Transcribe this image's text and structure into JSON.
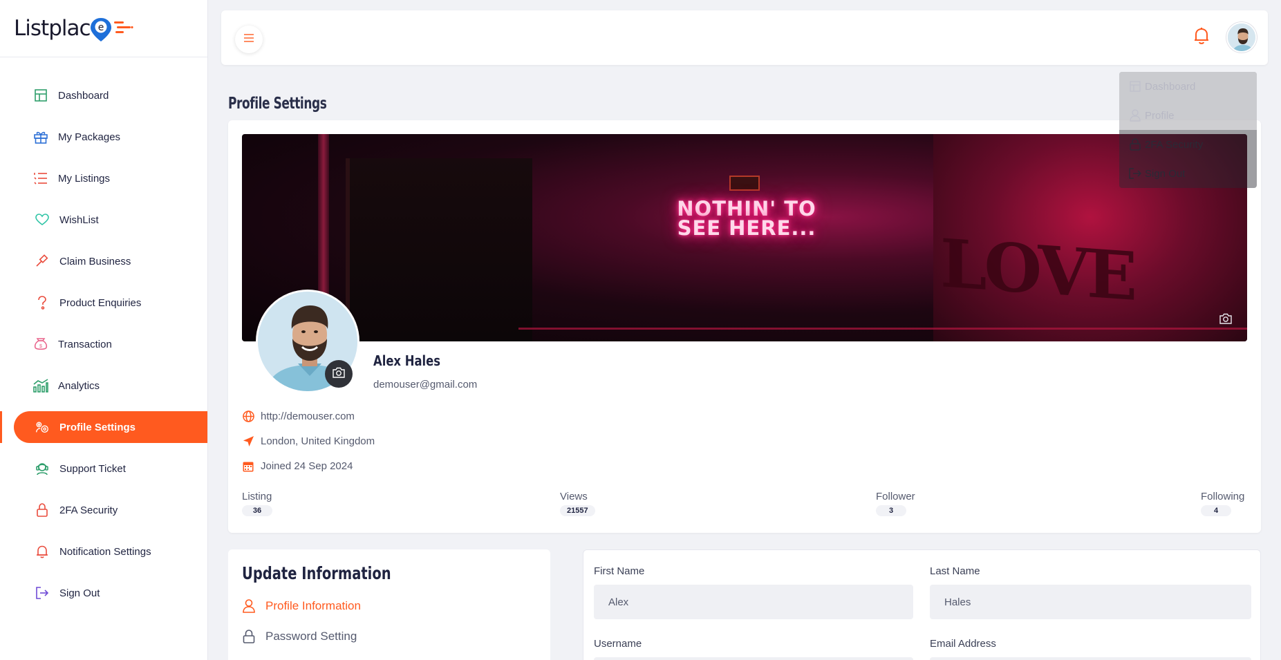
{
  "brand": {
    "logo_text": "Listplac",
    "logo_letter": "e",
    "colors": {
      "accent": "#ff5a1f",
      "sidebar_bg": "#ffffff",
      "page_bg": "#f1f2f6"
    }
  },
  "sidebar": {
    "items": [
      {
        "label": "Dashboard",
        "icon": "grid-icon"
      },
      {
        "label": "My Packages",
        "icon": "gift-icon"
      },
      {
        "label": "My Listings",
        "icon": "list-icon"
      },
      {
        "label": "WishList",
        "icon": "heart-icon"
      },
      {
        "label": "Claim Business",
        "icon": "gavel-icon"
      },
      {
        "label": "Product Enquiries",
        "icon": "question-icon"
      },
      {
        "label": "Transaction",
        "icon": "money-bag-icon"
      },
      {
        "label": "Analytics",
        "icon": "chart-icon"
      },
      {
        "label": "Profile Settings",
        "icon": "gears-icon"
      },
      {
        "label": "Support Ticket",
        "icon": "support-icon"
      },
      {
        "label": "2FA Security",
        "icon": "lock-icon"
      },
      {
        "label": "Notification Settings",
        "icon": "bell-icon"
      },
      {
        "label": "Sign Out",
        "icon": "sign-out-icon"
      }
    ],
    "active_index": 8
  },
  "user_menu": {
    "items": [
      {
        "label": "Dashboard",
        "icon": "grid-icon"
      },
      {
        "label": "Profile",
        "icon": "user-icon"
      },
      {
        "label": "2FA Security",
        "icon": "lock-icon"
      },
      {
        "label": "Sign Out",
        "icon": "sign-out-icon"
      }
    ]
  },
  "page": {
    "title": "Profile Settings"
  },
  "cover": {
    "neon_line1": "NOTHIN' TO",
    "neon_line2": "SEE HERE...",
    "wall_text": "LOVE"
  },
  "profile": {
    "name": "Alex Hales",
    "email": "demouser@gmail.com",
    "website": "http://demouser.com",
    "location": "London, United Kingdom",
    "joined": "Joined 24 Sep 2024",
    "stats": [
      {
        "label": "Listing",
        "value": "36"
      },
      {
        "label": "Views",
        "value": "21557"
      },
      {
        "label": "Follower",
        "value": "3"
      },
      {
        "label": "Following",
        "value": "4"
      }
    ]
  },
  "update_info": {
    "title": "Update Information",
    "items": [
      {
        "label": "Profile Information",
        "icon": "user-icon"
      },
      {
        "label": "Password Setting",
        "icon": "lock-icon"
      }
    ]
  },
  "form": {
    "first_name": {
      "label": "First Name",
      "value": "Alex"
    },
    "last_name": {
      "label": "Last Name",
      "value": "Hales"
    },
    "username": {
      "label": "Username"
    },
    "email": {
      "label": "Email Address"
    }
  }
}
